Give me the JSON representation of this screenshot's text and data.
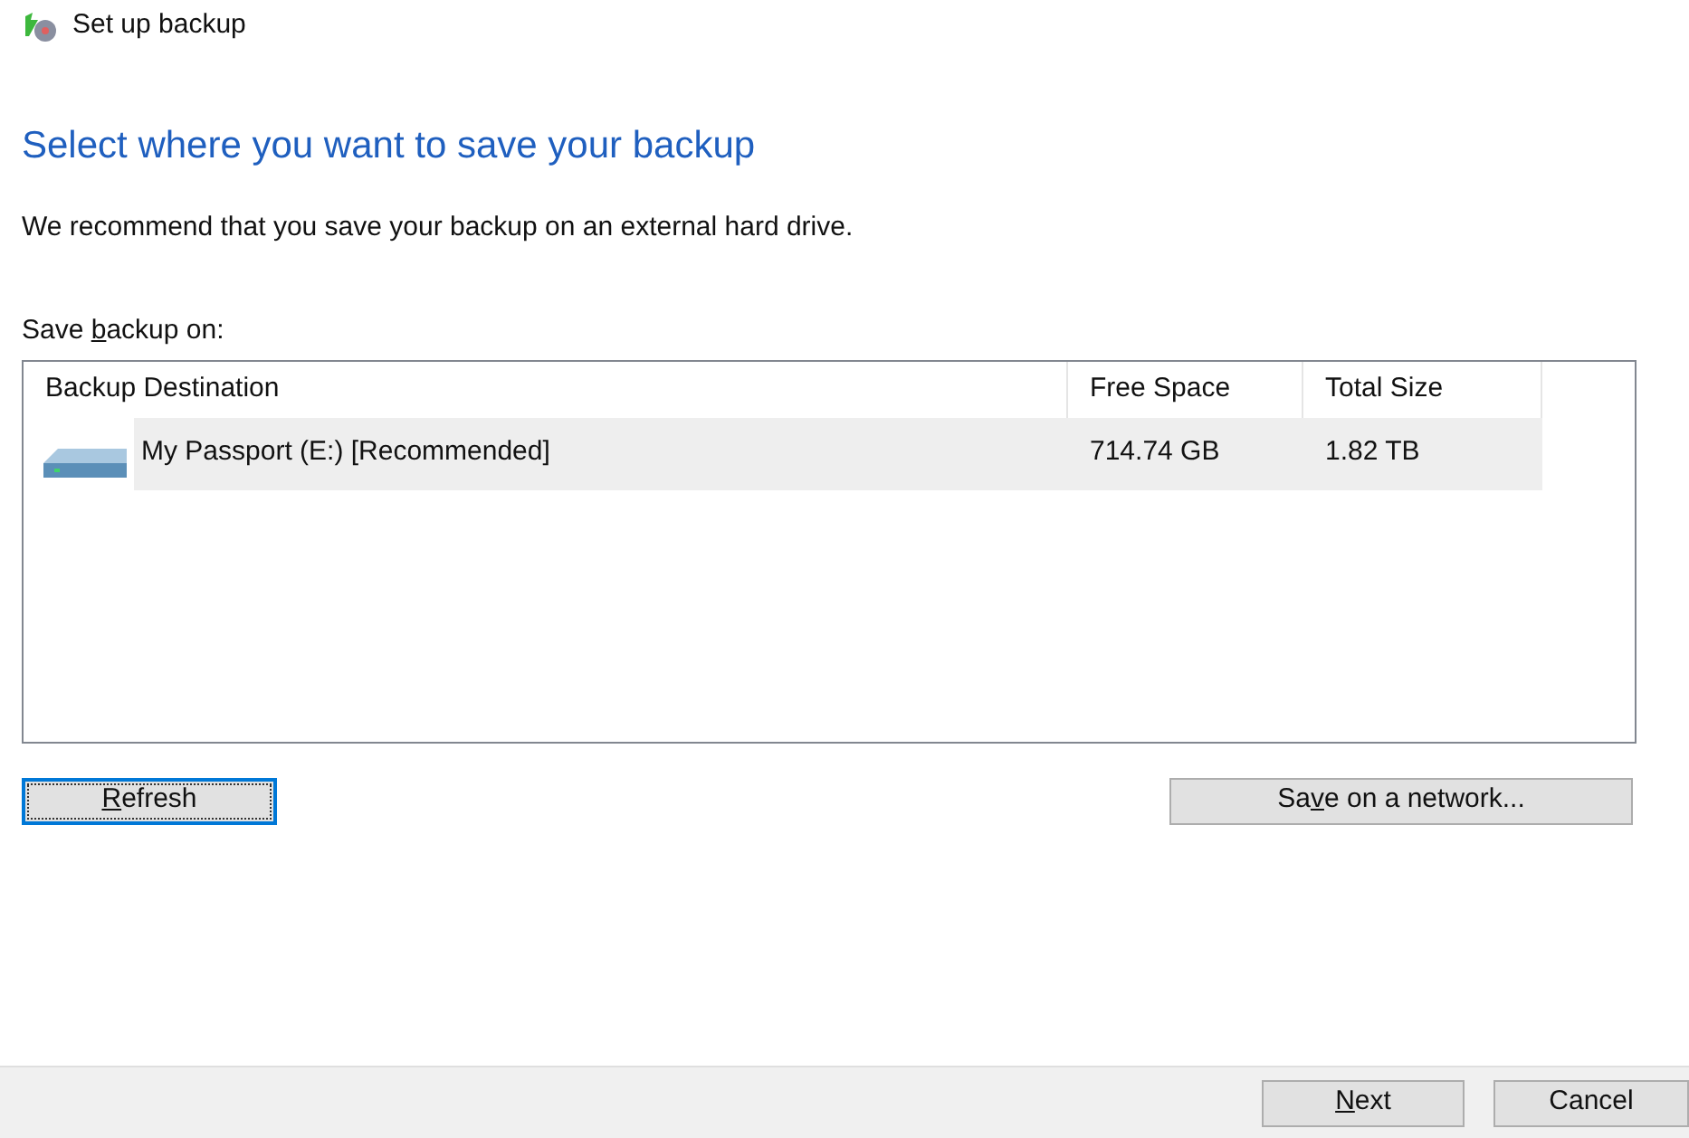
{
  "window": {
    "title": "Set up backup"
  },
  "heading": "Select where you want to save your backup",
  "description": "We recommend that you save your backup on an external hard drive.",
  "list_label": {
    "before": "Save ",
    "key": "b",
    "after": "ackup on:"
  },
  "table": {
    "columns": [
      "Backup Destination",
      "Free Space",
      "Total Size"
    ],
    "rows": [
      {
        "name": "My Passport (E:) [Recommended]",
        "free_space": "714.74 GB",
        "total_size": "1.82 TB",
        "selected": true
      }
    ]
  },
  "actions": [
    {
      "key": "R",
      "after": "efresh",
      "focused": true
    },
    {
      "before": "Sa",
      "key": "v",
      "after": "e on a network...",
      "focused": false
    }
  ],
  "footer_buttons": [
    {
      "key": "N",
      "after": "ext",
      "focused": false
    },
    {
      "before": "Cancel",
      "focused": false
    }
  ]
}
